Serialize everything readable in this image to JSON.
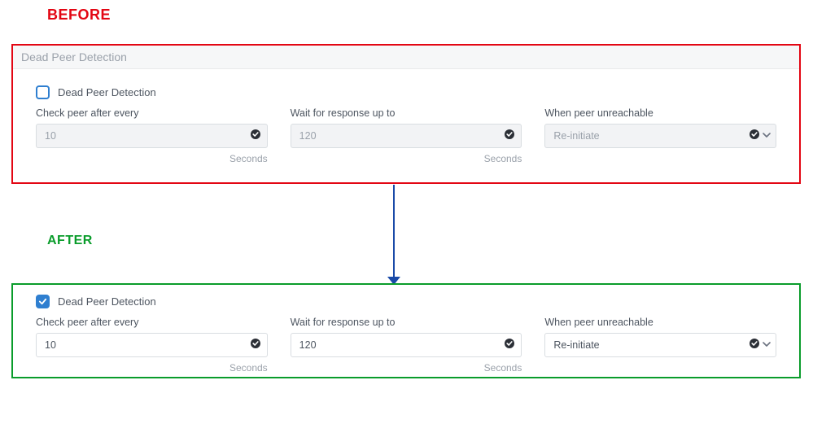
{
  "headings": {
    "before": "BEFORE",
    "after": "AFTER"
  },
  "section": {
    "title": "Dead Peer Detection"
  },
  "before": {
    "checkbox_label": "Dead Peer Detection",
    "checked": false,
    "fields": {
      "check_peer": {
        "label": "Check peer after every",
        "value": "10",
        "unit": "Seconds"
      },
      "wait_for": {
        "label": "Wait for response up to",
        "value": "120",
        "unit": "Seconds"
      },
      "unreachable": {
        "label": "When peer unreachable",
        "value": "Re-initiate"
      }
    }
  },
  "after": {
    "checkbox_label": "Dead Peer Detection",
    "checked": true,
    "fields": {
      "check_peer": {
        "label": "Check peer after every",
        "value": "10",
        "unit": "Seconds"
      },
      "wait_for": {
        "label": "Wait for response up to",
        "value": "120",
        "unit": "Seconds"
      },
      "unreachable": {
        "label": "When peer unreachable",
        "value": "Re-initiate"
      }
    }
  }
}
